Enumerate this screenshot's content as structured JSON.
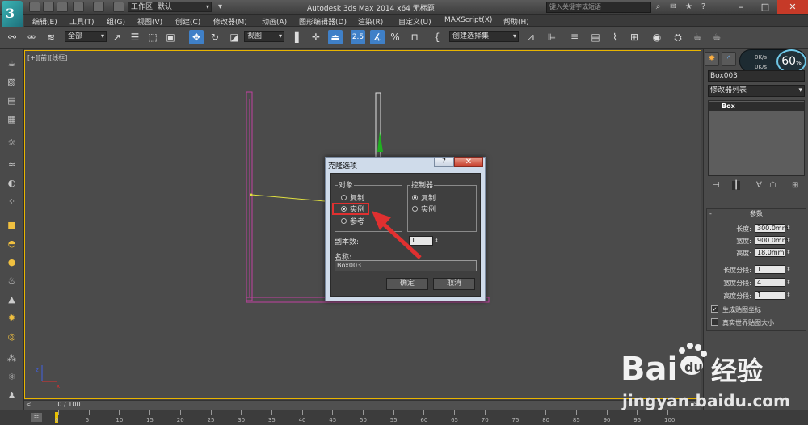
{
  "titlebar": {
    "workspace_label": "工作区: 默认",
    "app_title": "Autodesk 3ds Max  2014 x64      无标题",
    "search_placeholder": "键入关键字或短语"
  },
  "menu": [
    "编辑(E)",
    "工具(T)",
    "组(G)",
    "视图(V)",
    "创建(C)",
    "修改器(M)",
    "动画(A)",
    "图形编辑器(D)",
    "渲染(R)",
    "自定义(U)",
    "MAXScript(X)",
    "帮助(H)"
  ],
  "toolbar": {
    "selection_filter": "全部",
    "ref_coord": "视图",
    "snap_label": "2.5",
    "named_selection": "创建选择集"
  },
  "viewport": {
    "label": "[+][前][线框]"
  },
  "right_panel": {
    "object_name": "Box003",
    "modifier_list": "修改器列表",
    "stack_item": "Box",
    "rollout_title": "参数",
    "params": [
      {
        "label": "长度:",
        "value": "300.0mm"
      },
      {
        "label": "宽度:",
        "value": "900.0mm"
      },
      {
        "label": "高度:",
        "value": "18.0mm"
      },
      {
        "label": "长度分段:",
        "value": "1"
      },
      {
        "label": "宽度分段:",
        "value": "4"
      },
      {
        "label": "高度分段:",
        "value": "1"
      }
    ],
    "checkboxes": [
      {
        "label": "生成贴图坐标",
        "checked": true
      },
      {
        "label": "真实世界贴图大小",
        "checked": false
      }
    ]
  },
  "gauge": {
    "percent": "60",
    "unit": "%",
    "rate_up": "0K/s",
    "rate_down": "0K/s"
  },
  "timeline": {
    "slider": "0 / 100",
    "ticks": [
      "0",
      "5",
      "10",
      "15",
      "20",
      "25",
      "30",
      "35",
      "40",
      "45",
      "50",
      "55",
      "60",
      "65",
      "70",
      "75",
      "80",
      "85",
      "90",
      "95",
      "100"
    ]
  },
  "dialog": {
    "title": "克隆选项",
    "help": "?",
    "close": "✕",
    "object_group": "对象",
    "object_options": [
      "复制",
      "实例",
      "参考"
    ],
    "object_selected": 1,
    "controller_group": "控制器",
    "controller_options": [
      "复制",
      "实例"
    ],
    "controller_selected": 0,
    "copies_label": "副本数:",
    "copies_value": "1",
    "name_label": "名称:",
    "name_value": "Box003",
    "ok": "确定",
    "cancel": "取消"
  },
  "watermark": {
    "brand_a": "Bai",
    "brand_b": "du",
    "brand_c": "经验",
    "url": "jingyan.baidu.com"
  },
  "colors": {
    "accent": "#3f80c8",
    "viewport_border": "#e8b400",
    "highlight": "#e03030",
    "arrow": "#e03030",
    "object_magenta": "#c040a0",
    "object_yellow": "#e0e040"
  }
}
